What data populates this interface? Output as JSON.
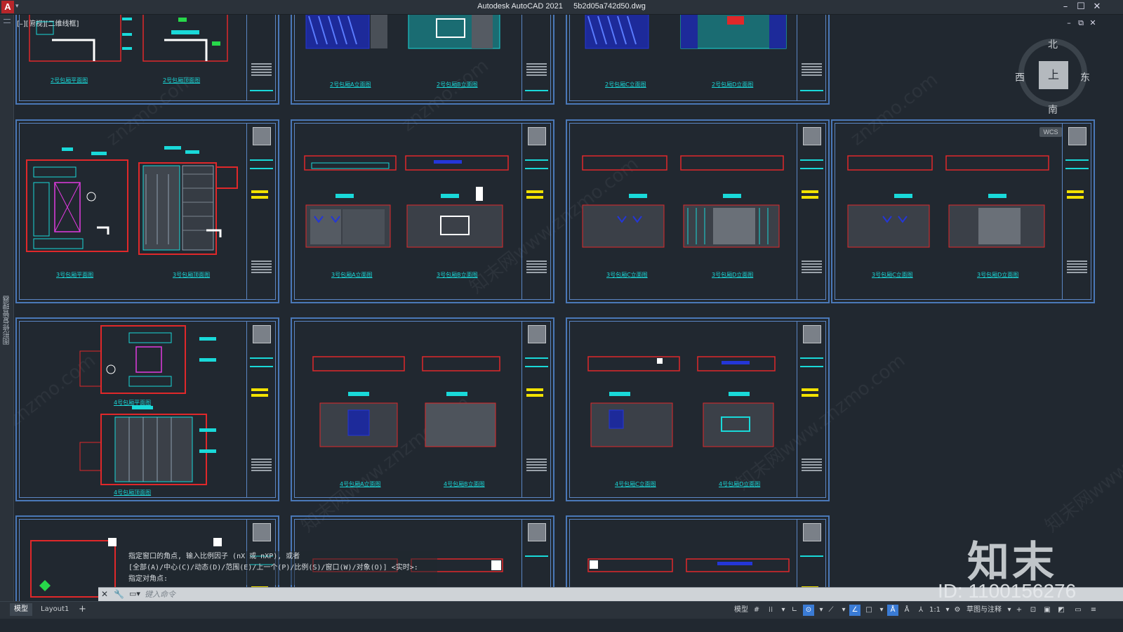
{
  "app": {
    "logo_letter": "A",
    "title": "Autodesk AutoCAD 2021     5b2d05a742d50.dwg",
    "window_buttons": [
      "–",
      "☐",
      "✕"
    ],
    "doc_buttons": [
      "–",
      "⧉",
      "✕"
    ]
  },
  "viewport": {
    "label": "[–][俯视][二维线框]"
  },
  "left_palette": {
    "label": "图形修复管理器"
  },
  "viewcube": {
    "north": "北",
    "south": "南",
    "west": "西",
    "east": "东",
    "face": "上",
    "ucs": "WCS"
  },
  "sheets": [
    {
      "captions": [
        "2号包厢平面图",
        "2号包厢顶面图"
      ]
    },
    {
      "captions": [
        "2号包厢A立面图",
        "2号包厢B立面图"
      ]
    },
    {
      "captions": [
        "2号包厢C立面图",
        "2号包厢D立面图"
      ]
    },
    {
      "captions": [
        "3号包厢平面图",
        "3号包厢顶面图"
      ]
    },
    {
      "captions": [
        "3号包厢A立面图",
        "3号包厢B立面图"
      ]
    },
    {
      "captions": [
        "3号包厢C立面图",
        "3号包厢D立面图"
      ]
    },
    {
      "captions": [
        "3号包厢C立面图",
        "3号包厢D立面图"
      ]
    },
    {
      "captions": [
        "4号包厢平面图",
        "4号包厢顶面图"
      ]
    },
    {
      "captions": [
        "4号包厢A立面图",
        "4号包厢B立面图"
      ]
    },
    {
      "captions": [
        "4号包厢C立面图",
        "4号包厢D立面图"
      ]
    }
  ],
  "command": {
    "history": [
      "指定窗口的角点, 输入比例因子 (nX 或 nXP), 或者",
      "[全部(A)/中心(C)/动态(D)/范围(E)/上一个(P)/比例(S)/窗口(W)/对象(O)] <实时>:",
      "指定对角点:"
    ],
    "close_icon": "✕",
    "customize_icon": "🔧",
    "prompt_icon": "▭▾",
    "placeholder": "键入命令"
  },
  "layout_tabs": [
    {
      "label": "模型",
      "active": true
    },
    {
      "label": "Layout1",
      "active": false
    },
    {
      "label": "+",
      "active": false
    }
  ],
  "status_bar": {
    "model_label": "模型",
    "scale": "1:1",
    "workspace": "草图与注释"
  },
  "watermark": {
    "logo": "知末",
    "id": "ID: 1100156276",
    "site": "znzmo.com",
    "site_cn": "知末网www.znzmo.com"
  },
  "colors": {
    "background": "#212830",
    "sheet_border": "#4a78b8",
    "cyan": "#19d9d9",
    "red": "#e0282a",
    "blue": "#2436d8",
    "yellow": "#f2e200"
  }
}
